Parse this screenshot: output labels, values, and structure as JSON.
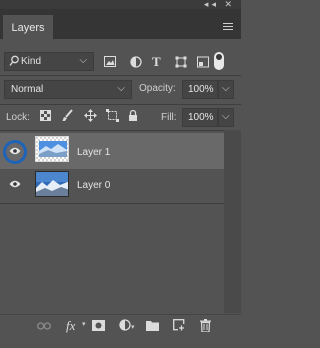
{
  "panel": {
    "title": "Layers",
    "top_icons": "◂◂ ✕"
  },
  "filter": {
    "kind_label": "Kind",
    "icons": [
      "image-icon",
      "adjustment-icon",
      "type-icon",
      "shape-icon",
      "smart-object-icon"
    ]
  },
  "blend": {
    "mode": "Normal",
    "opacity_label": "Opacity:",
    "opacity_value": "100%"
  },
  "lock": {
    "label": "Lock:",
    "fill_label": "Fill:",
    "fill_value": "100%"
  },
  "layers": [
    {
      "name": "Layer 1",
      "selected": true,
      "visible": true
    },
    {
      "name": "Layer 0",
      "selected": false,
      "visible": true
    }
  ],
  "bottom_icons": [
    "link-icon",
    "fx-icon",
    "mask-icon",
    "adjustment-layer-icon",
    "group-folder-icon",
    "new-layer-icon",
    "trash-icon"
  ],
  "colors": {
    "panel": "#535353",
    "tabbar": "#353535",
    "selected_row": "#696969",
    "highlight_ring": "#1e63b8"
  }
}
